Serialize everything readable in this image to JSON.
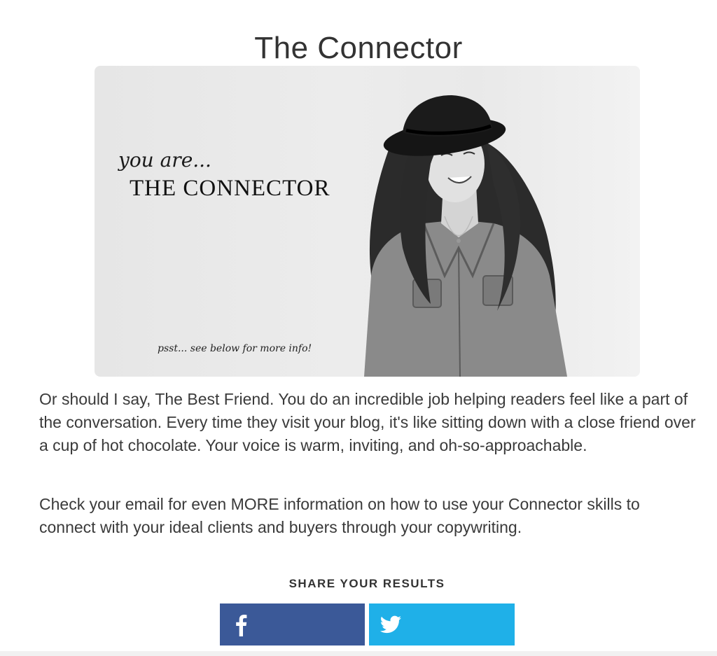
{
  "page": {
    "title": "The Connector"
  },
  "hero": {
    "intro": "you are...",
    "name": "THE CONNECTOR",
    "note": "psst... see below for more info!"
  },
  "content": {
    "paragraph_1": "Or should I say, The Best Friend. You do an incredible job helping readers feel like a part of the conversation. Every time they visit your blog, it's like sitting down with a close friend over a cup of hot chocolate. Your voice is warm, inviting, and oh-so-approachable.",
    "paragraph_2": "Check your email for even MORE information on how to use your Connector skills to connect with your ideal clients and buyers through your copywriting."
  },
  "share": {
    "label": "SHARE YOUR RESULTS",
    "buttons": [
      {
        "icon": "facebook-icon",
        "color": "#3b5998"
      },
      {
        "icon": "twitter-icon",
        "color": "#1fb0e8"
      }
    ]
  }
}
